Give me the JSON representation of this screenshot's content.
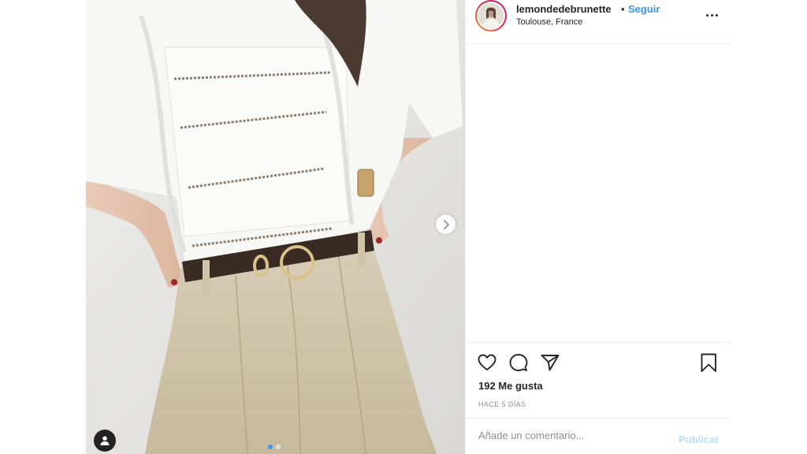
{
  "post": {
    "author": {
      "username": "lemondedebrunette",
      "separator": "•",
      "follow_label": "Seguir",
      "location": "Toulouse, France",
      "avatar_icon": "profile-avatar"
    },
    "photo": {
      "carousel_count": 2,
      "carousel_active": 1,
      "next_icon": "chevron-right-icon",
      "tag_icon": "person-tag-icon"
    },
    "actions": {
      "like_icon": "heart-icon",
      "comment_icon": "comment-bubble-icon",
      "share_icon": "paper-plane-icon",
      "save_icon": "bookmark-icon"
    },
    "likes_text": "192 Me gusta",
    "time_text": "HACE 5 DÍAS",
    "comment_box": {
      "placeholder": "Añade un comentario...",
      "publish_label": "Publicar"
    },
    "colors": {
      "link_blue": "#3897f0",
      "publish_disabled": "#b2dffc",
      "border": "#efefef"
    }
  }
}
